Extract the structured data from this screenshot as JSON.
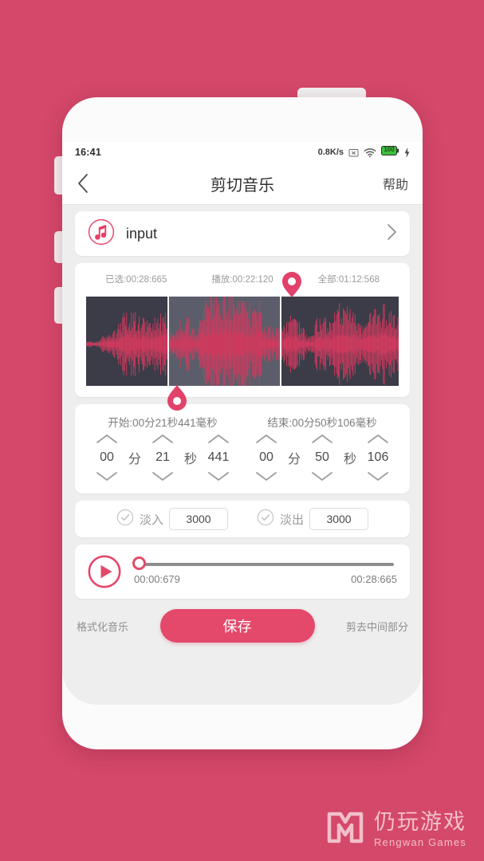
{
  "status_bar": {
    "time": "16:41",
    "net_speed": "0.8K/s",
    "icons": [
      "no-sim-icon",
      "wifi-icon",
      "battery-icon",
      "charging-bolt-icon"
    ],
    "battery_level": "100"
  },
  "nav": {
    "back_icon": "chevron-left-icon",
    "title": "剪切音乐",
    "help_label": "帮助"
  },
  "file_row": {
    "icon": "music-note-icon",
    "name": "input",
    "chevron_icon": "chevron-right-icon"
  },
  "time_stats": [
    {
      "label": "已选",
      "value": "已选:00:28:665"
    },
    {
      "label": "播放",
      "value": "播放:00:22:120"
    },
    {
      "label": "全部",
      "value": "全部:01:12:568"
    }
  ],
  "waveform": {
    "selection_start_pct": 26,
    "selection_end_pct": 62,
    "start_marker_icon": "pin-marker-up",
    "end_marker_icon": "pin-marker-down",
    "wave_color": "#cf3a5e",
    "bg_color": "#3b3c48",
    "selection_color": "#5c5d6a"
  },
  "steppers": {
    "start": {
      "label": "开始:00分21秒441毫秒",
      "minutes": "00",
      "minute_unit": "分",
      "seconds": "21",
      "second_unit": "秒",
      "millis": "441",
      "up_icon": "chevron-up-icon",
      "down_icon": "chevron-down-icon"
    },
    "end": {
      "label": "结束:00分50秒106毫秒",
      "minutes": "00",
      "minute_unit": "分",
      "seconds": "50",
      "second_unit": "秒",
      "millis": "106",
      "up_icon": "chevron-up-icon",
      "down_icon": "chevron-down-icon"
    }
  },
  "fade": {
    "in": {
      "checkbox_icon": "circle-check-icon",
      "label": "淡入",
      "value": "3000"
    },
    "out": {
      "checkbox_icon": "circle-check-icon",
      "label": "淡出",
      "value": "3000"
    }
  },
  "player": {
    "play_icon": "play-circle-icon",
    "progress_pct": 0,
    "current_time": "00:00:679",
    "total_time": "00:28:665"
  },
  "bottom_actions": {
    "left_label": "格式化音乐",
    "save_label": "保存",
    "right_label": "剪去中间部分"
  },
  "watermark": {
    "logo_icon": "rengwan-logo-icon",
    "cn": "仍玩游戏",
    "en": "Rengwan Games"
  },
  "theme": {
    "page_bg": "#d4486a",
    "accent": "#e4486b",
    "screen_bg": "#efeeee"
  }
}
